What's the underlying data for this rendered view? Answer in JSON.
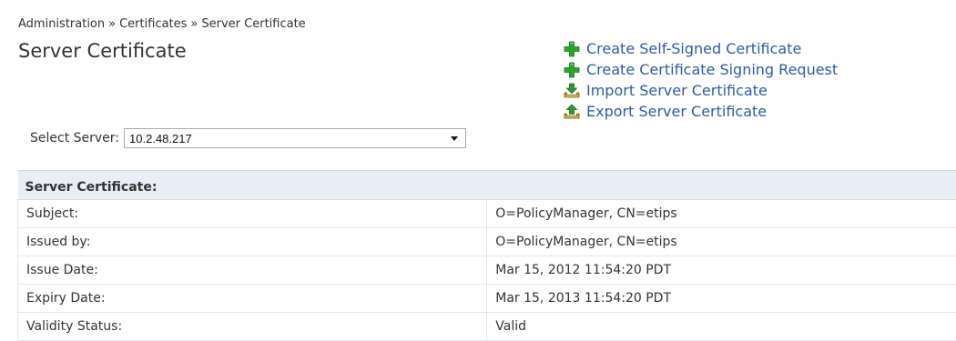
{
  "breadcrumb": {
    "items": [
      "Administration",
      "Certificates",
      "Server Certificate"
    ],
    "separator": "»"
  },
  "page": {
    "title": "Server Certificate"
  },
  "actions": [
    {
      "label": "Create Self-Signed Certificate",
      "icon": "plus-icon"
    },
    {
      "label": "Create Certificate Signing Request",
      "icon": "plus-icon"
    },
    {
      "label": "Import Server Certificate",
      "icon": "import-icon"
    },
    {
      "label": "Export Server Certificate",
      "icon": "export-icon"
    }
  ],
  "server_select": {
    "label": "Select Server:",
    "value": "10.2.48.217"
  },
  "certificate": {
    "header": "Server Certificate:",
    "rows": [
      {
        "key": "Subject:",
        "value": "O=PolicyManager, CN=etips"
      },
      {
        "key": "Issued by:",
        "value": "O=PolicyManager, CN=etips"
      },
      {
        "key": "Issue Date:",
        "value": "Mar 15, 2012 11:54:20 PDT"
      },
      {
        "key": "Expiry Date:",
        "value": "Mar 15, 2013 11:54:20 PDT"
      },
      {
        "key": "Validity Status:",
        "value": "Valid"
      }
    ]
  },
  "colors": {
    "link": "#2f5aa8",
    "plus_icon": "#2aa52a",
    "arrow_icon_import": "#2d9a2d",
    "arrow_icon_export": "#2d9a2d",
    "tray_icon": "#c79a1e",
    "table_header_bg": "#e8edf6"
  }
}
